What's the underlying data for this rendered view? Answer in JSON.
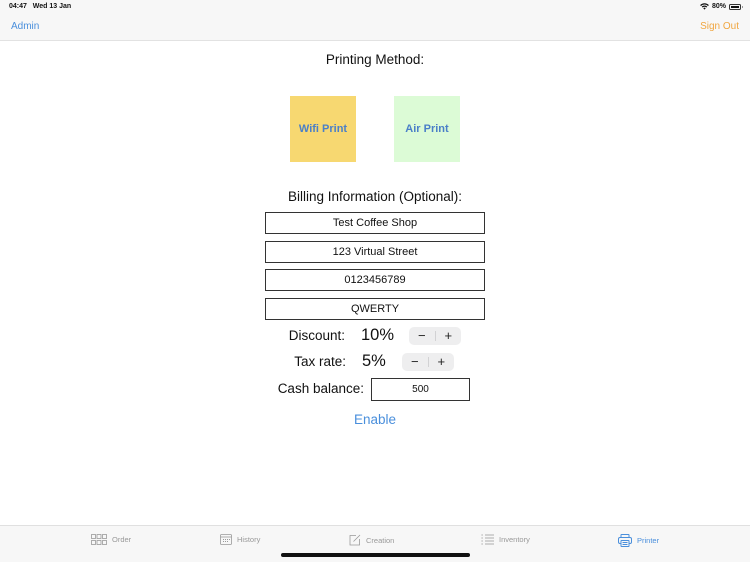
{
  "status_bar": {
    "time": "04:47",
    "date": "Wed 13 Jan",
    "battery_percent_label": "80%",
    "battery_level": 0.8,
    "wifi_icon": "wifi-icon",
    "battery_icon": "battery-icon"
  },
  "nav": {
    "left_button": "Admin",
    "right_button": "Sign Out"
  },
  "printing": {
    "title": "Printing Method:",
    "options": [
      {
        "label": "Wifi Print",
        "bg_color": "#f7d871",
        "selected": true
      },
      {
        "label": "Air Print",
        "bg_color": "#dcfbd6",
        "selected": false
      }
    ]
  },
  "billing": {
    "title": "Billing Information (Optional):",
    "fields": [
      {
        "value": "Test Coffee Shop"
      },
      {
        "value": "123 Virtual Street"
      },
      {
        "value": "0123456789"
      },
      {
        "value": "QWERTY"
      }
    ]
  },
  "settings": {
    "discount_label": "Discount:",
    "discount_value": "10%",
    "tax_label": "Tax rate:",
    "tax_value": "5%",
    "stepper_minus": "−",
    "stepper_plus": "+",
    "cash_label": "Cash balance:",
    "cash_value": "500",
    "enable_label": "Enable"
  },
  "tabs": [
    {
      "label": "Order",
      "icon": "grid-icon",
      "active": false
    },
    {
      "label": "History",
      "icon": "calendar-icon",
      "active": false
    },
    {
      "label": "Creation",
      "icon": "edit-icon",
      "active": false
    },
    {
      "label": "Inventory",
      "icon": "list-icon",
      "active": false
    },
    {
      "label": "Printer",
      "icon": "printer-icon",
      "active": true
    }
  ],
  "colors": {
    "accent_blue": "#4a8fdc",
    "sign_out_orange": "#f0a640"
  }
}
